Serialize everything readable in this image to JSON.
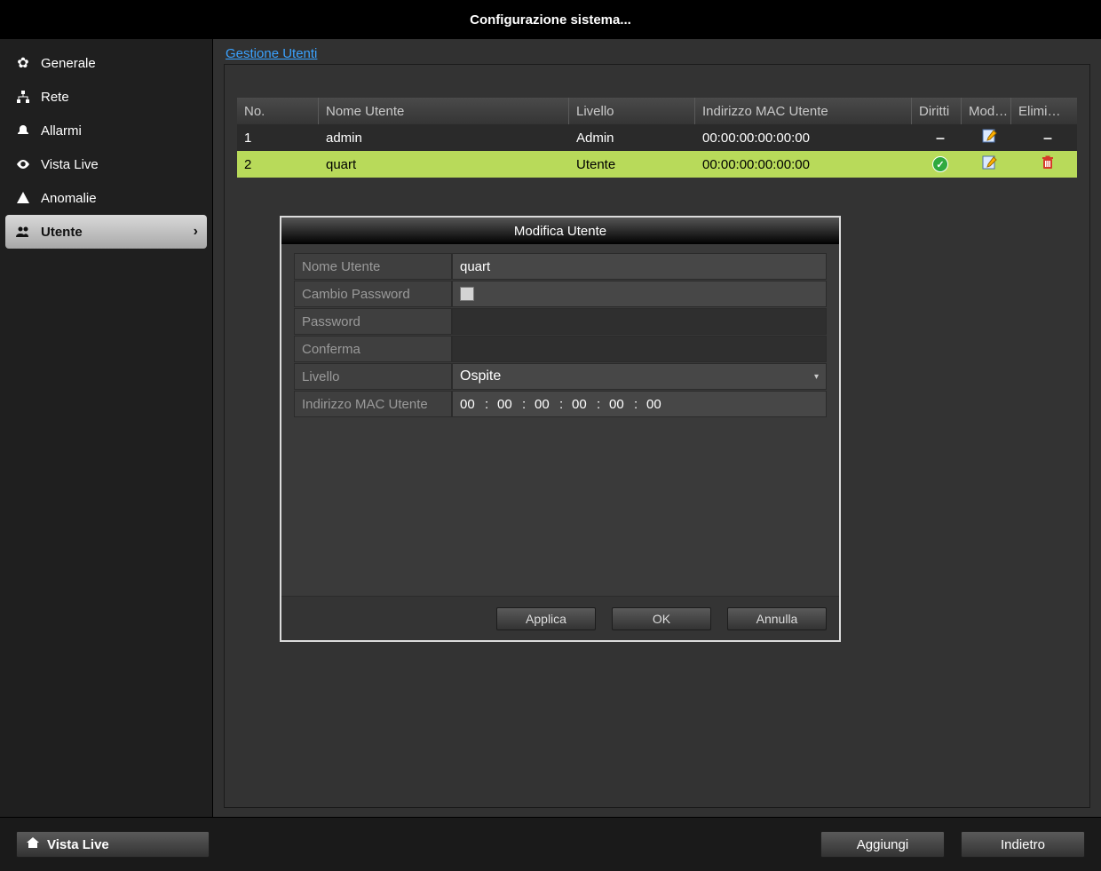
{
  "title": "Configurazione sistema...",
  "sidebar": {
    "items": [
      {
        "label": "Generale"
      },
      {
        "label": "Rete"
      },
      {
        "label": "Allarmi"
      },
      {
        "label": "Vista Live"
      },
      {
        "label": "Anomalie"
      },
      {
        "label": "Utente"
      }
    ]
  },
  "section_title": "Gestione Utenti",
  "table": {
    "headers": {
      "no": "No.",
      "name": "Nome Utente",
      "level": "Livello",
      "mac": "Indirizzo MAC Utente",
      "rights": "Diritti",
      "mod": "Mod…",
      "del": "Elimi…"
    },
    "rows": [
      {
        "no": "1",
        "name": "admin",
        "level": "Admin",
        "mac": "00:00:00:00:00:00"
      },
      {
        "no": "2",
        "name": "quart",
        "level": "Utente",
        "mac": "00:00:00:00:00:00"
      }
    ]
  },
  "modal": {
    "title": "Modifica Utente",
    "labels": {
      "name": "Nome Utente",
      "changepw": "Cambio Password",
      "password": "Password",
      "confirm": "Conferma",
      "level": "Livello",
      "mac": "Indirizzo MAC Utente"
    },
    "values": {
      "name": "quart",
      "level": "Ospite",
      "mac_parts": [
        "00",
        "00",
        "00",
        "00",
        "00",
        "00"
      ]
    },
    "buttons": {
      "apply": "Applica",
      "ok": "OK",
      "cancel": "Annulla"
    }
  },
  "bottom": {
    "live": "Vista Live",
    "add": "Aggiungi",
    "back": "Indietro"
  }
}
